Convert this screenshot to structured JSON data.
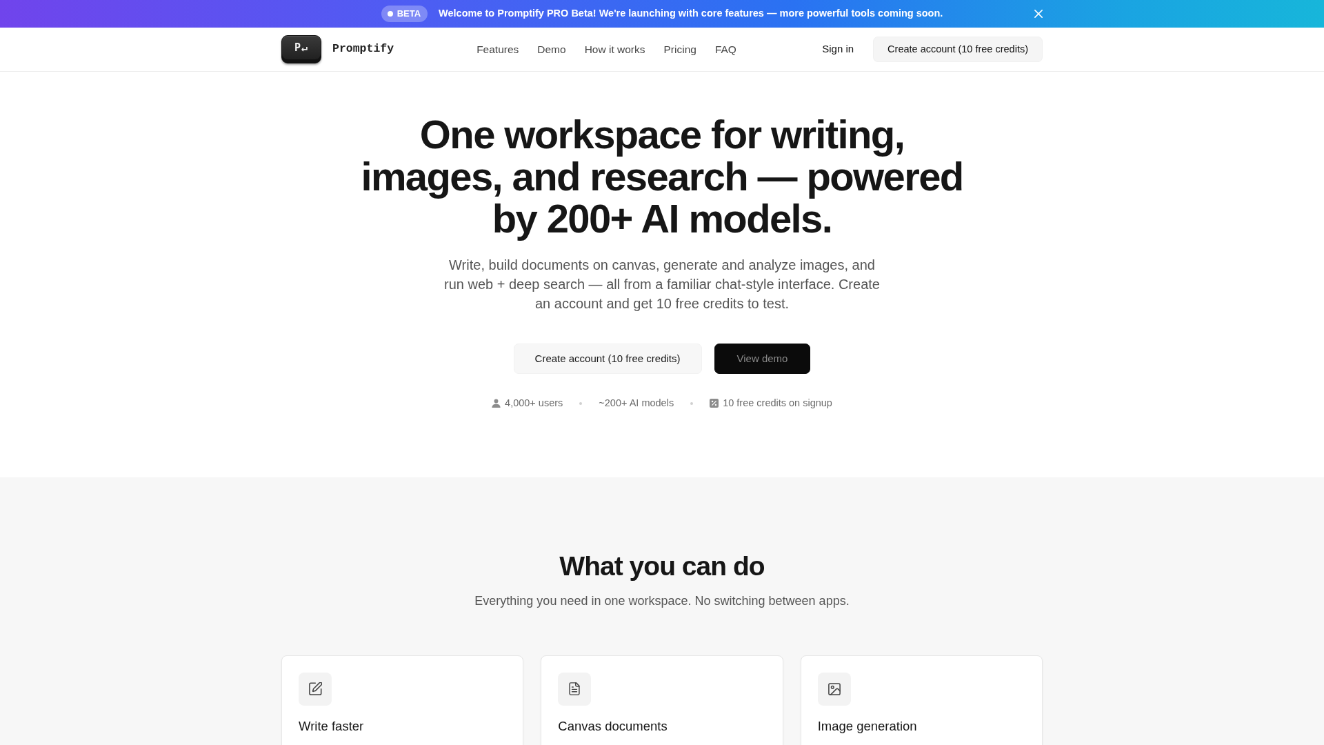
{
  "announcement_bar": {
    "badge": "BETA",
    "message": "Welcome to Promptify PRO Beta! We're launching with core features — more powerful tools coming soon."
  },
  "navbar": {
    "logo_key": "P↵",
    "brand": "Promptify",
    "links": [
      {
        "label": "Features"
      },
      {
        "label": "Demo"
      },
      {
        "label": "How it works"
      },
      {
        "label": "Pricing"
      },
      {
        "label": "FAQ"
      }
    ],
    "sign_in": "Sign in",
    "cta": "Create account (10 free credits)"
  },
  "hero": {
    "title": "One workspace for writing, images, and research — powered by 200+ AI models.",
    "subtitle": "Write, build documents on canvas, generate and analyze images, and run web + deep search — all from a familiar chat-style interface. Create an account and get 10 free credits to test.",
    "buttons": [
      {
        "label": "Create account (10 free credits)",
        "kind": "secondary"
      },
      {
        "label": "View demo",
        "kind": "primary"
      }
    ],
    "stats": [
      {
        "text": "4,000+ users",
        "kind": "users"
      },
      {
        "text": "~200+ AI models",
        "kind": "models"
      },
      {
        "text": "10 free credits on signup",
        "kind": "credits"
      }
    ]
  },
  "features": {
    "title": "What you can do",
    "subtitle": "Everything you need in one workspace. No switching between apps.",
    "cards": [
      {
        "title": "Write faster",
        "kind": "writing"
      },
      {
        "title": "Canvas documents",
        "kind": "document"
      },
      {
        "title": "Image generation",
        "kind": "image"
      }
    ]
  }
}
